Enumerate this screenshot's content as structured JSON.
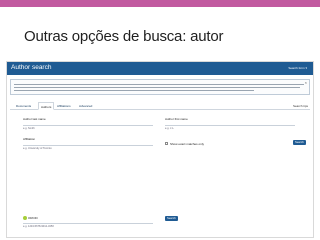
{
  "slide": {
    "title": "Outras opções de busca: autor",
    "accent_color": "#c25aa0"
  },
  "app": {
    "title": "Author search",
    "top_right_link": "Search form ▾",
    "bar_color": "#1f5b93"
  },
  "tabs": {
    "items": [
      "Documents",
      "Authors",
      "Affiliations",
      "Advanced"
    ],
    "active": "Authors",
    "right_link": "Search tips"
  },
  "form": {
    "last_name_label": "Author last name",
    "last_name_hint": "e.g. Smith",
    "first_name_label": "Author first name",
    "first_name_hint": "e.g. J.L.",
    "affiliation_label": "Affiliation",
    "affiliation_hint": "e.g. University of Toronto",
    "exact_match_label": "Show exact matches only",
    "search_button": "Search",
    "orcid_label": "ORCID",
    "orcid_hint": "e.g. 1234-5678-9012-345X",
    "orcid_search_button": "Search"
  },
  "icons": {
    "notice_close": "close-icon",
    "orcid": "orcid-icon"
  }
}
